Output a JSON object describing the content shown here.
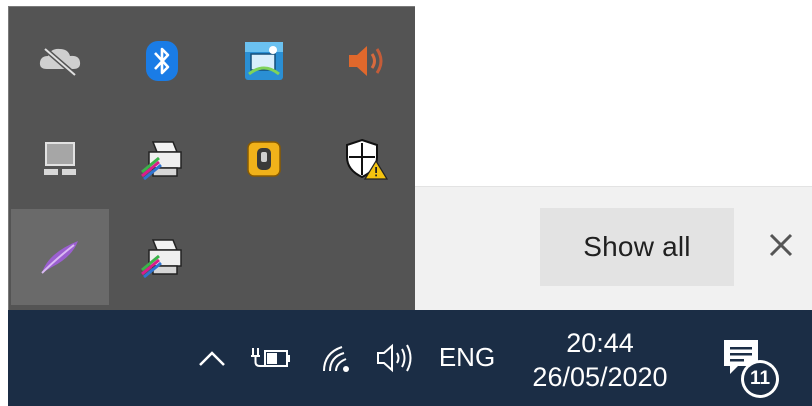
{
  "download_bar": {
    "show_all_label": "Show all",
    "close_glyph": "✕"
  },
  "tray_flyout": {
    "icons": [
      {
        "name": "onedrive-offline-icon"
      },
      {
        "name": "bluetooth-icon"
      },
      {
        "name": "network-manager-icon"
      },
      {
        "name": "speaker-icon"
      },
      {
        "name": "remote-display-icon"
      },
      {
        "name": "printer-icon"
      },
      {
        "name": "usb-lock-icon"
      },
      {
        "name": "windows-security-warning-icon"
      },
      {
        "name": "quill-feather-icon"
      },
      {
        "name": "printer-icon"
      }
    ]
  },
  "taskbar": {
    "overflow_chevron": "^",
    "language": "ENG",
    "time": "20:44",
    "date": "26/05/2020",
    "notification_count": "11"
  }
}
